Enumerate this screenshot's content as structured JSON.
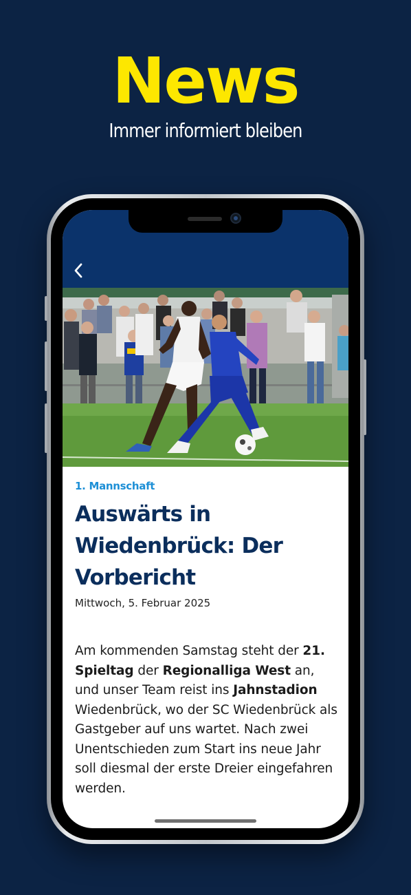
{
  "promo": {
    "title": "News",
    "subtitle": "Immer informiert bleiben"
  },
  "app": {
    "header_color": "#0b336b",
    "back_icon": "chevron-left-icon"
  },
  "article": {
    "category": "1. Mannschaft",
    "title": "Auswärts in Wiedenbrück: Der Vorbericht",
    "date": "Mittwoch, 5. Februar 2025",
    "body": {
      "t1": "Am kommenden Samstag steht der ",
      "b1": "21. Spieltag",
      "t2": " der ",
      "b2": "Regionalliga West",
      "t3": " an, und unser Team reist ins ",
      "b3": "Jahnstadion",
      "t4": " Wiedenbrück, wo der SC Wiedenbrück als Gastgeber auf uns wartet. Nach zwei Unentschieden zum Start ins neue Jahr soll diesmal der erste Dreier eingefahren werden."
    }
  },
  "colors": {
    "background": "#0c2344",
    "accent_yellow": "#fde700",
    "category_blue": "#1d8fd6",
    "headline_navy": "#0b2e5c"
  }
}
